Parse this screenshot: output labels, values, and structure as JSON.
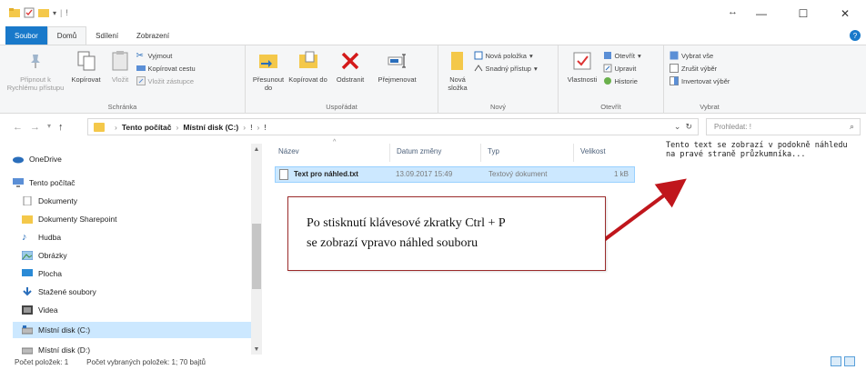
{
  "ribbon_tabs": [
    {
      "label": "Soubor"
    },
    {
      "label": "Domů"
    },
    {
      "label": "Sdílení"
    },
    {
      "label": "Zobrazení"
    }
  ],
  "ribbon": {
    "clipboard": {
      "pin_label": "Připnout k Rychlému přístupu",
      "copy_label": "Kopírovat",
      "paste_label": "Vložit",
      "cut_label": "Vyjmout",
      "copy_path_label": "Kopírovat cestu",
      "paste_shortcut_label": "Vložit zástupce",
      "group_label": "Schránka"
    },
    "organize": {
      "move_label": "Přesunout do",
      "copy_to_label": "Kopírovat do",
      "delete_label": "Odstranit",
      "rename_label": "Přejmenovat",
      "group_label": "Uspořádat"
    },
    "new": {
      "new_folder_label": "Nová složka",
      "new_item_label": "Nová položka",
      "easy_access_label": "Snadný přístup",
      "group_label": "Nový"
    },
    "open": {
      "properties_label": "Vlastnosti",
      "open_label": "Otevřít",
      "edit_label": "Upravit",
      "history_label": "Historie",
      "group_label": "Otevřít"
    },
    "select": {
      "select_all_label": "Vybrat vše",
      "select_none_label": "Zrušit výběr",
      "invert_label": "Invertovat výběr",
      "group_label": "Vybrat"
    }
  },
  "address": {
    "crumb_1": "Tento počítač",
    "crumb_2": "Místní disk (C:)",
    "crumb_3": "!",
    "crumb_4": "!",
    "search_placeholder": "Prohledat: !"
  },
  "navpane": {
    "items": [
      {
        "label": "OneDrive"
      },
      {
        "label": "Tento počítač"
      },
      {
        "label": "Dokumenty"
      },
      {
        "label": "Dokumenty Sharepoint"
      },
      {
        "label": "Hudba"
      },
      {
        "label": "Obrázky"
      },
      {
        "label": "Plocha"
      },
      {
        "label": "Stažené soubory"
      },
      {
        "label": "Videa"
      },
      {
        "label": "Místní disk (C:)"
      },
      {
        "label": "Místní disk (D:)"
      }
    ]
  },
  "file_list": {
    "columns": {
      "name": "Název",
      "date": "Datum změny",
      "type": "Typ",
      "size": "Velikost"
    },
    "rows": [
      {
        "name": "Text pro náhled.txt",
        "date": "13.09.2017 15:49",
        "type": "Textový dokument",
        "size": "1 kB"
      }
    ]
  },
  "preview": {
    "text": "Tento text se zobrazí v podokně náhledu na pravé straně průzkumníka..."
  },
  "annotation": {
    "line1": "Po stisknutí klávesové zkratky Ctrl + P",
    "line2": "se zobrazí vpravo náhled souboru"
  },
  "status": {
    "item_count": "Počet položek: 1",
    "selected": "Počet vybraných položek: 1; 70 bajtů"
  },
  "colors": {
    "accent": "#1979ca",
    "selection": "#cce8ff",
    "annotation_arrow": "#c0161c"
  }
}
